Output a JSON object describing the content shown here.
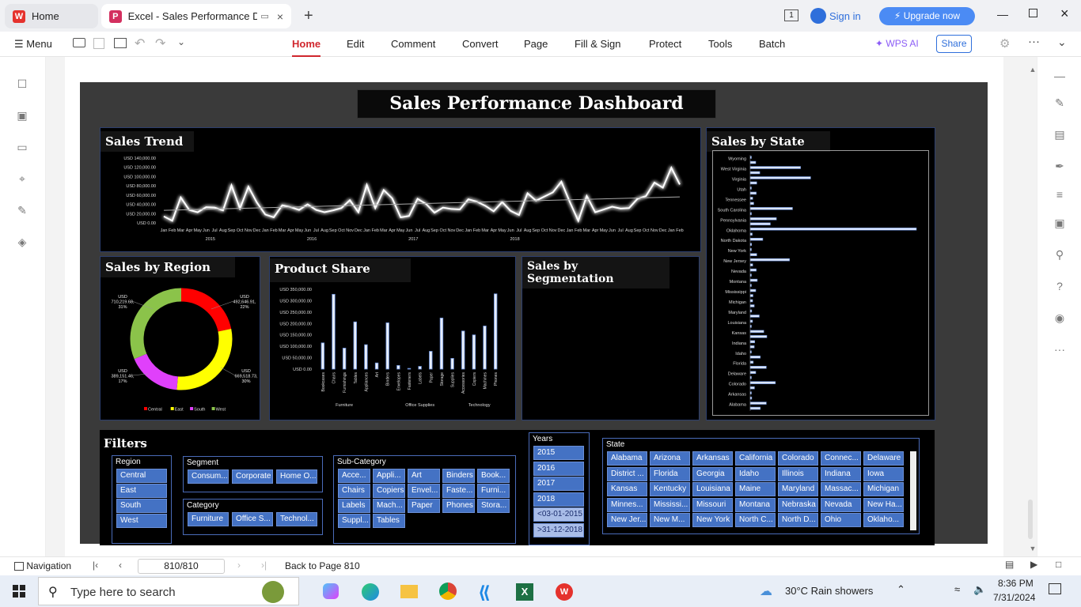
{
  "browser": {
    "home_tab": "Home",
    "doc_tab": "Excel - Sales Performance Dasl",
    "sign_in": "Sign in",
    "upgrade": "Upgrade now",
    "page_count_badge": "1"
  },
  "menu": {
    "menu_label": "Menu",
    "items": [
      "Home",
      "Edit",
      "Comment",
      "Convert",
      "Page",
      "Fill & Sign",
      "Protect",
      "Tools",
      "Batch"
    ],
    "wps_ai": "WPS AI",
    "share": "Share"
  },
  "dashboard": {
    "title": "Sales Performance Dashboard",
    "sales_trend_title": "Sales Trend",
    "sales_by_state_title": "Sales by State",
    "sales_by_region_title": "Sales by Region",
    "product_share_title": "Product Share",
    "segmentation_title": "Sales by Segmentation",
    "filters_title": "Filters"
  },
  "chart_data": [
    {
      "type": "line",
      "title": "Sales Trend",
      "ylim": [
        0,
        140000
      ],
      "yticks": [
        "USD 140,000.00",
        "USD 120,000.00",
        "USD 100,000.00",
        "USD 80,000.00",
        "USD 60,000.00",
        "USD 40,000.00",
        "USD 20,000.00",
        "USD 0.00"
      ],
      "months": [
        "Jan",
        "Feb",
        "Mar",
        "Apr",
        "May",
        "Jun",
        "Jul",
        "Aug",
        "Sep",
        "Oct",
        "Nov",
        "Dec"
      ],
      "years": [
        "2015",
        "2016",
        "2017",
        "2018"
      ],
      "values": [
        14000,
        4500,
        55000,
        28000,
        23000,
        34000,
        33000,
        27000,
        81000,
        31000,
        78000,
        44000,
        18000,
        12000,
        38000,
        34000,
        28000,
        40000,
        28000,
        23000,
        27000,
        32000,
        49000,
        23000,
        82000,
        32000,
        71000,
        53000,
        12000,
        15000,
        52000,
        41000,
        22000,
        33000,
        30000,
        29000,
        51000,
        46000,
        37000,
        25000,
        45000,
        26000,
        17000,
        64000,
        48000,
        57000,
        66000,
        89000,
        45000,
        4500,
        58000,
        23000,
        29000,
        35000,
        31000,
        32000,
        52000,
        58000,
        87000,
        76000,
        119000,
        83000
      ],
      "trendline": true
    },
    {
      "type": "bar",
      "orientation": "horizontal",
      "title": "Sales by State",
      "visible_labels": [
        "Wyoming",
        "West Virginia",
        "Virginia",
        "Utah",
        "Tennessee",
        "South Carolina",
        "Pennsylvania",
        "Oklahoma",
        "North Dakota",
        "New York",
        "New Jersey",
        "Nevada",
        "Montana",
        "Mississippi",
        "Michigan",
        "Maryland",
        "Louisiana",
        "Kansas",
        "Indiana",
        "Idaho",
        "Florida",
        "Delaware",
        "Colorado",
        "Arkansas",
        "Alabama"
      ],
      "values": [
        1600,
        11000,
        100000,
        19000,
        120000,
        13000,
        2000,
        12000,
        5000,
        7000,
        84000,
        2400,
        52000,
        40000,
        330000,
        4000,
        25000,
        2700,
        2000,
        13000,
        78000,
        5000,
        12000,
        1800,
        14000,
        1000,
        11000,
        5500,
        4800,
        8000,
        3000,
        18000,
        4600,
        2000,
        27000,
        33000,
        9000,
        8000,
        300,
        20000,
        6000,
        32000,
        11000,
        2000,
        50000,
        8500,
        2000,
        3000,
        32000,
        20000
      ]
    },
    {
      "type": "pie",
      "title": "Sales by Region",
      "categories": [
        "Central",
        "East",
        "South",
        "West"
      ],
      "values": [
        492646.91,
        669518.73,
        389151.46,
        710219.68
      ],
      "labels": [
        "USD 492,646.91, 22%",
        "USD 669,518.73, 30%",
        "USD 389,151.46, 17%",
        "USD 710,219.68, 31%"
      ],
      "colors": [
        "#ff0000",
        "#ffff00",
        "#e040fb",
        "#8bc34a"
      ],
      "legend": "bottom"
    },
    {
      "type": "bar",
      "title": "Product Share",
      "ylim": [
        0,
        350000
      ],
      "yticks": [
        "USD 350,000.00",
        "USD 300,000.00",
        "USD 250,000.00",
        "USD 200,000.00",
        "USD 150,000.00",
        "USD 100,000.00",
        "USD 50,000.00",
        "USD 0.00"
      ],
      "categories": [
        "Bookcases",
        "Chairs",
        "Furnishings",
        "Tables",
        "Appliances",
        "Art",
        "Binders",
        "Envelopes",
        "Fasteners",
        "Labels",
        "Paper",
        "Storage",
        "Supplies",
        "Accessories",
        "Copiers",
        "Machines",
        "Phones"
      ],
      "groups": [
        "Furniture",
        "Office Supplies",
        "Technology"
      ],
      "values": [
        115000,
        328000,
        92000,
        207000,
        107000,
        27000,
        203000,
        16000,
        3000,
        12000,
        78000,
        224000,
        47000,
        167000,
        150000,
        189000,
        330000
      ]
    }
  ],
  "filters": {
    "region": {
      "label": "Region",
      "items": [
        "Central",
        "East",
        "South",
        "West"
      ]
    },
    "segment": {
      "label": "Segment",
      "items": [
        "Consum...",
        "Corporate",
        "Home O..."
      ]
    },
    "category": {
      "label": "Category",
      "items": [
        "Furniture",
        "Office S...",
        "Technol..."
      ]
    },
    "subcategory": {
      "label": "Sub-Category",
      "items": [
        "Acce...",
        "Appli...",
        "Art",
        "Binders",
        "Book...",
        "Chairs",
        "Copiers",
        "Envel...",
        "Faste...",
        "Furni...",
        "Labels",
        "Mach...",
        "Paper",
        "Phones",
        "Stora...",
        "Suppl...",
        "Tables"
      ]
    },
    "years": {
      "label": "Years",
      "items": [
        "2015",
        "2016",
        "2017",
        "2018",
        "<03-01-2015",
        ">31-12-2018"
      ]
    },
    "state": {
      "label": "State",
      "items": [
        "Alabama",
        "Arizona",
        "Arkansas",
        "California",
        "Colorado",
        "Connec...",
        "Delaware",
        "District ...",
        "Florida",
        "Georgia",
        "Idaho",
        "Illinois",
        "Indiana",
        "Iowa",
        "Kansas",
        "Kentucky",
        "Louisiana",
        "Maine",
        "Maryland",
        "Massac...",
        "Michigan",
        "Minnes...",
        "Mississi...",
        "Missouri",
        "Montana",
        "Nebraska",
        "Nevada",
        "New Ha...",
        "New Jer...",
        "New M...",
        "New York",
        "North C...",
        "North D...",
        "Ohio",
        "Oklaho..."
      ]
    }
  },
  "status": {
    "navigation": "Navigation",
    "page_input": "810/810",
    "back_to_page": "Back to Page 810"
  },
  "taskbar": {
    "search_placeholder": "Type here to search",
    "weather": "30°C  Rain showers",
    "time": "8:36 PM",
    "date": "7/31/2024"
  }
}
